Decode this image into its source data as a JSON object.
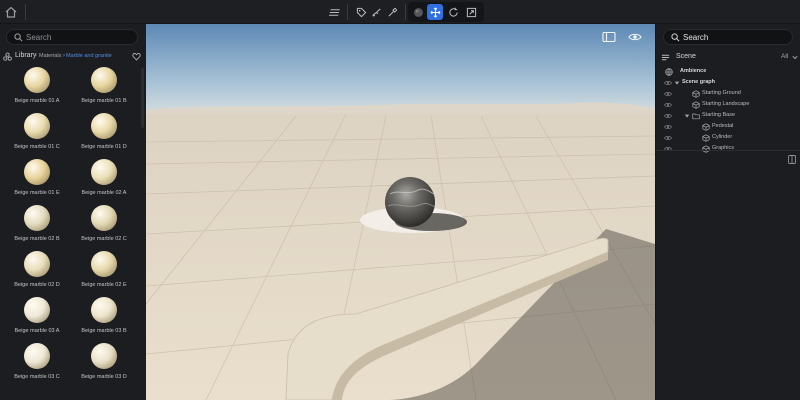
{
  "toolbar": {
    "home_icon": "home-icon",
    "tools": [
      {
        "icon": "layers-icon"
      },
      {
        "icon": "tag-icon"
      },
      {
        "icon": "paint-brush-icon"
      },
      {
        "icon": "eyedropper-icon"
      },
      {
        "icon": "material-ball-icon"
      },
      {
        "icon": "move-icon",
        "active": true
      },
      {
        "icon": "rotate-icon"
      },
      {
        "icon": "scale-icon"
      }
    ],
    "accent_color": "#2f6fe0"
  },
  "library": {
    "search_placeholder": "Search",
    "title": "Library",
    "breadcrumb": [
      "Materials",
      "Marble and granite"
    ],
    "separator": ">",
    "materials": [
      {
        "name": "Beige marble 01 A",
        "color": "#e8d7a3"
      },
      {
        "name": "Beige marble 01 B",
        "color": "#e6d59e"
      },
      {
        "name": "Beige marble 01 C",
        "color": "#eadcaf"
      },
      {
        "name": "Beige marble 01 D",
        "color": "#e9d9a8"
      },
      {
        "name": "Beige marble 01 E",
        "color": "#e7d39a"
      },
      {
        "name": "Beige marble 02 A",
        "color": "#ece0b8"
      },
      {
        "name": "Beige marble 02 B",
        "color": "#e4dcc0"
      },
      {
        "name": "Beige marble 02 C",
        "color": "#e3d8b4"
      },
      {
        "name": "Beige marble 02 D",
        "color": "#e8ddba"
      },
      {
        "name": "Beige marble 02 E",
        "color": "#e6d8ac"
      },
      {
        "name": "Beige marble 03 A",
        "color": "#efe9d8"
      },
      {
        "name": "Beige marble 03 B",
        "color": "#ece4cc"
      },
      {
        "name": "Beige marble 03 C",
        "color": "#eee8d6"
      },
      {
        "name": "Beige marble 03 D",
        "color": "#e9e1c8"
      }
    ]
  },
  "scene": {
    "search_placeholder": "Search",
    "title": "Scene",
    "filter": "All",
    "tree": [
      {
        "label": "Ambience",
        "level": 0,
        "bold": true,
        "icon": "globe-icon"
      },
      {
        "label": "Scene graph",
        "level": 0,
        "bold": true,
        "expanded": true
      },
      {
        "label": "Starting Ground",
        "level": 1,
        "icon": "cube-icon"
      },
      {
        "label": "Starting Landscape",
        "level": 1,
        "icon": "cube-icon"
      },
      {
        "label": "Starting Base",
        "level": 1,
        "icon": "folder-icon",
        "expanded": true
      },
      {
        "label": "Pedestal",
        "level": 2,
        "icon": "cube-icon"
      },
      {
        "label": "Cylinder",
        "level": 2,
        "icon": "cube-icon"
      },
      {
        "label": "Graphics",
        "level": 2,
        "icon": "cube-icon"
      }
    ]
  },
  "viewport": {
    "buttons": [
      {
        "icon": "panel-layout-icon"
      },
      {
        "icon": "eye-icon"
      }
    ]
  }
}
